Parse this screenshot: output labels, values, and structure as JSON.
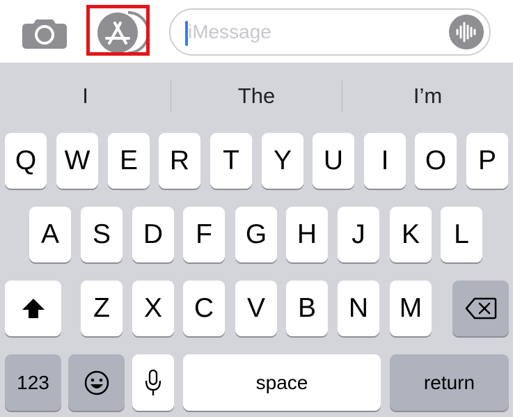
{
  "top_bar": {
    "camera_icon": "camera-icon",
    "appstore_icon": "app-store-icon",
    "highlight_color": "#e3151a",
    "message_field": {
      "placeholder": "iMessage",
      "audio_icon": "audio-waveform-icon"
    }
  },
  "suggestions": [
    "I",
    "The",
    "I’m"
  ],
  "rows": [
    [
      "Q",
      "W",
      "E",
      "R",
      "T",
      "Y",
      "U",
      "I",
      "O",
      "P"
    ],
    [
      "A",
      "S",
      "D",
      "F",
      "G",
      "H",
      "J",
      "K",
      "L"
    ],
    [
      "Z",
      "X",
      "C",
      "V",
      "B",
      "N",
      "M"
    ]
  ],
  "special_keys": {
    "shift_icon": "shift-icon",
    "delete_icon": "delete-backspace-icon",
    "numbers": "123",
    "emoji_icon": "emoji-icon",
    "dictation_icon": "microphone-icon",
    "space": "space",
    "return": "return"
  },
  "colors": {
    "keyboard_bg": "#d3d5db",
    "key_bg": "#ffffff",
    "dark_key_bg": "#aeb3be",
    "cursor": "#2f7cf6"
  }
}
